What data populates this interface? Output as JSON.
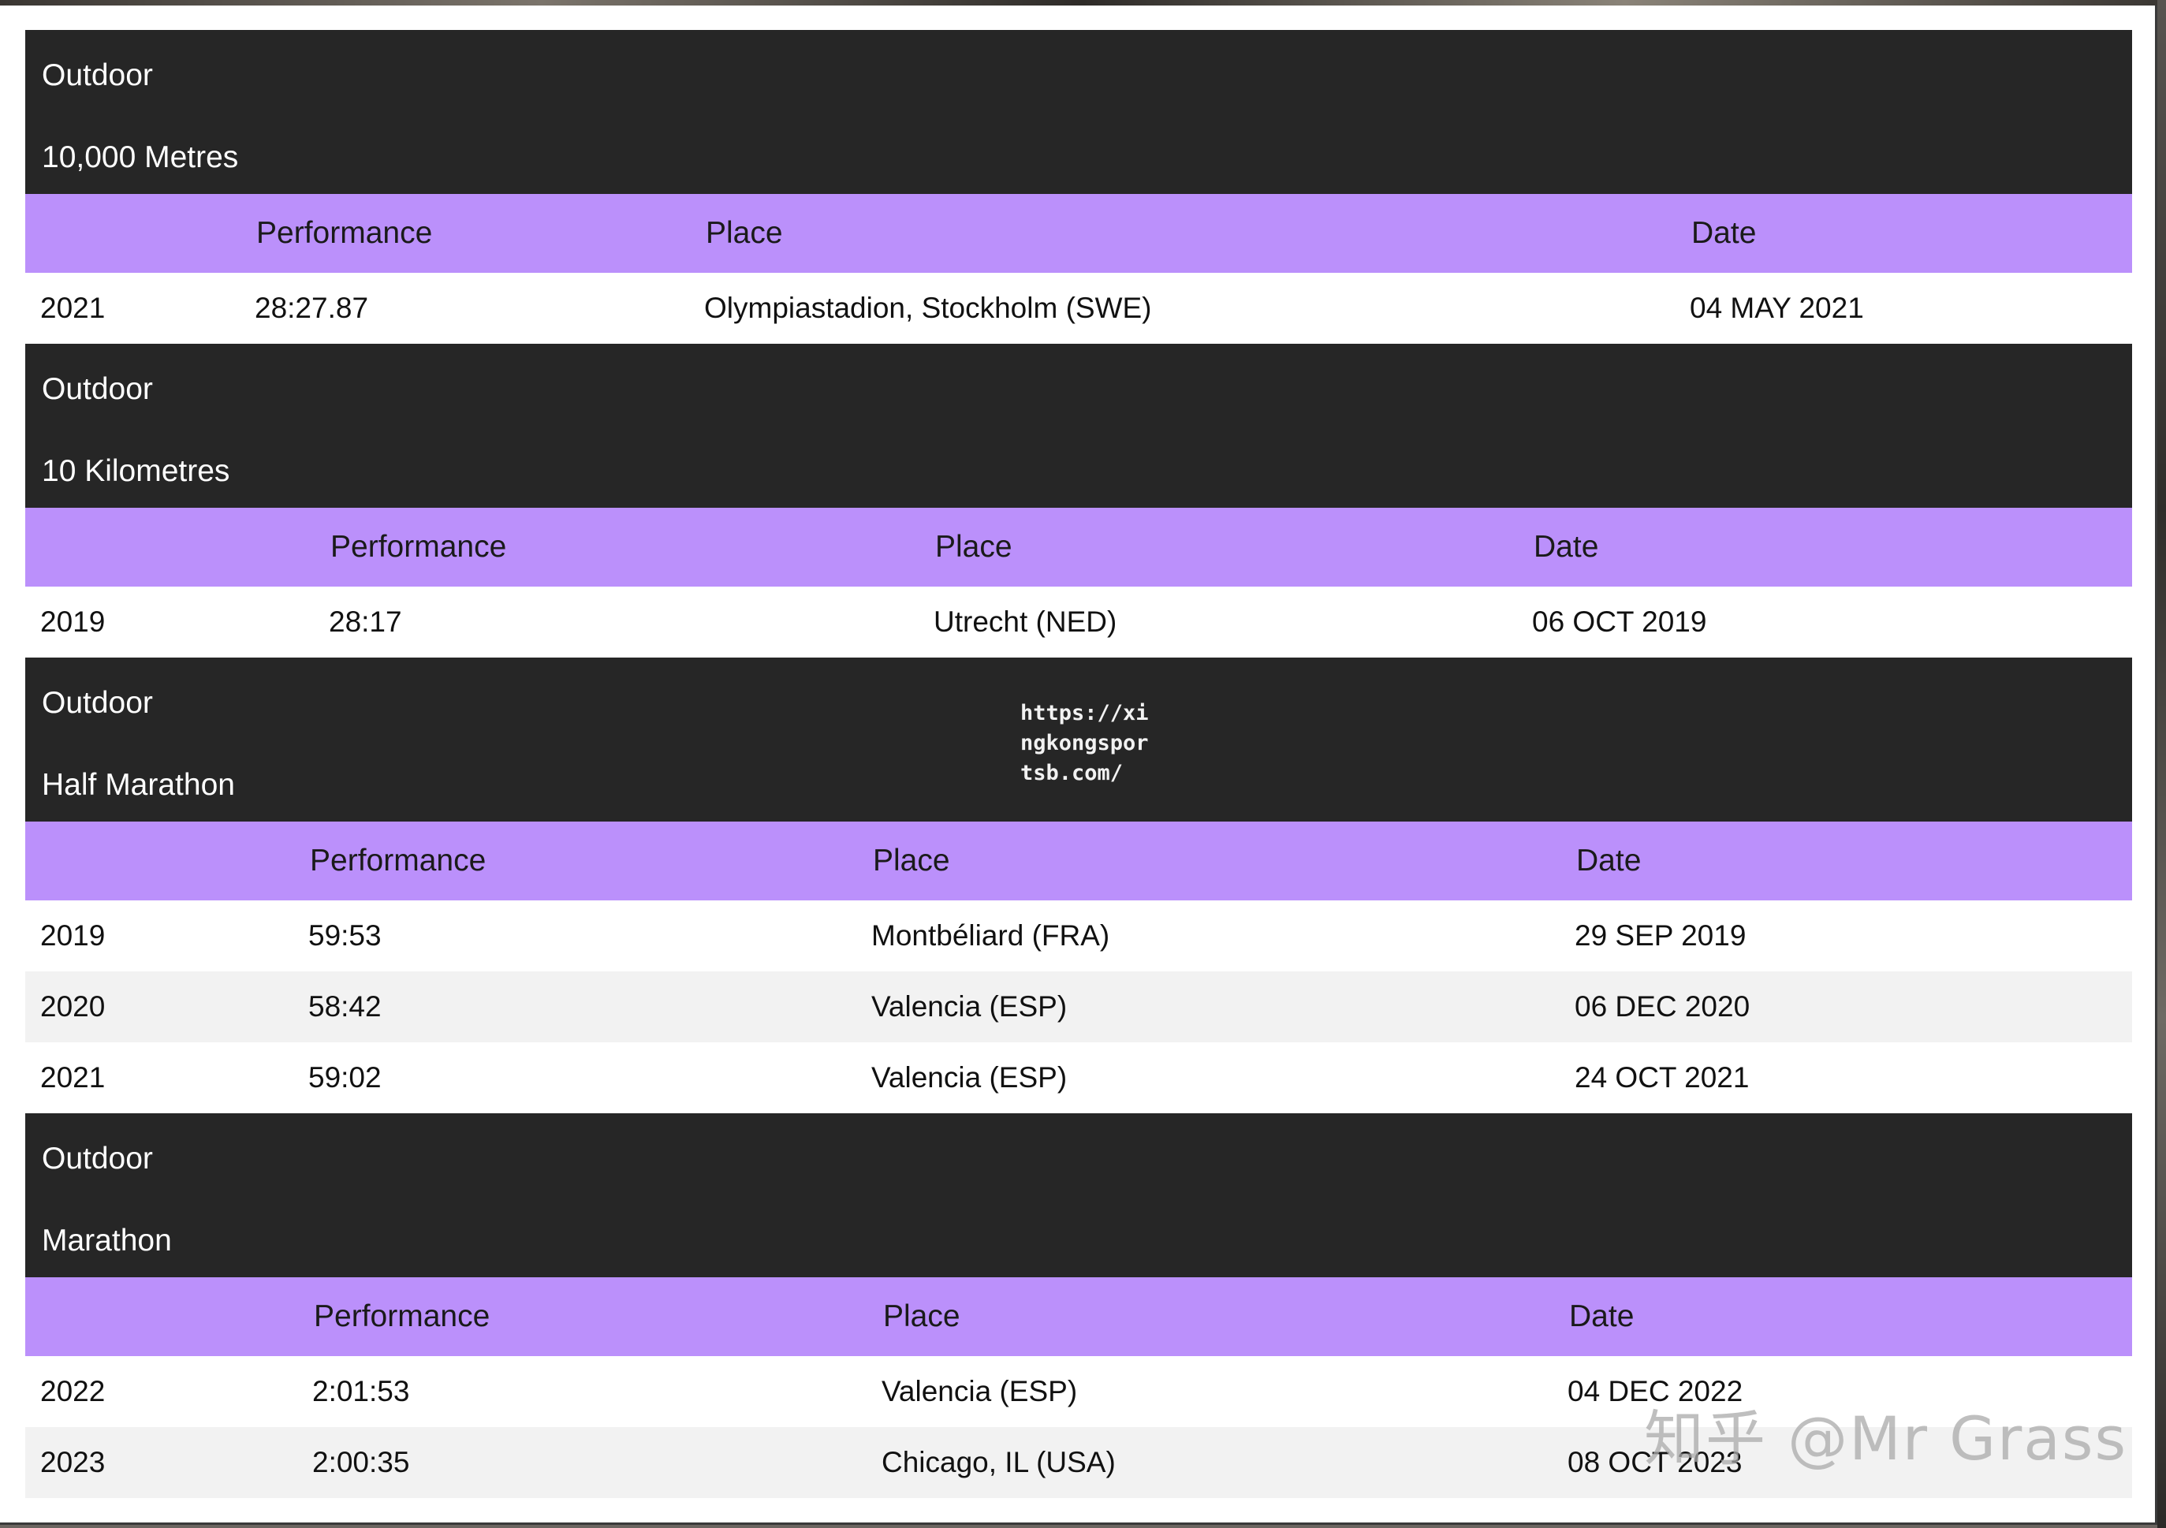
{
  "watermark": {
    "url": "https://xi\nngkongspor\ntsb.com/",
    "credit": "知乎 @Mr Grass"
  },
  "sections": [
    {
      "environment": "Outdoor",
      "event": "10,000 Metres",
      "headers": {
        "performance": "Performance",
        "place": "Place",
        "date": "Date"
      },
      "rows": [
        {
          "year": "2021",
          "performance": "28:27.87",
          "place": "Olympiastadion, Stockholm (SWE)",
          "date": "04 MAY 2021"
        }
      ]
    },
    {
      "environment": "Outdoor",
      "event": "10 Kilometres",
      "headers": {
        "performance": "Performance",
        "place": "Place",
        "date": "Date"
      },
      "rows": [
        {
          "year": "2019",
          "performance": "28:17",
          "place": "Utrecht (NED)",
          "date": "06 OCT 2019"
        }
      ]
    },
    {
      "environment": "Outdoor",
      "event": "Half Marathon",
      "headers": {
        "performance": "Performance",
        "place": "Place",
        "date": "Date"
      },
      "rows": [
        {
          "year": "2019",
          "performance": "59:53",
          "place": "Montbéliard (FRA)",
          "date": "29 SEP 2019"
        },
        {
          "year": "2020",
          "performance": "58:42",
          "place": "Valencia (ESP)",
          "date": "06 DEC 2020"
        },
        {
          "year": "2021",
          "performance": "59:02",
          "place": "Valencia (ESP)",
          "date": "24 OCT 2021"
        }
      ]
    },
    {
      "environment": "Outdoor",
      "event": "Marathon",
      "headers": {
        "performance": "Performance",
        "place": "Place",
        "date": "Date"
      },
      "rows": [
        {
          "year": "2022",
          "performance": "2:01:53",
          "place": "Valencia (ESP)",
          "date": "04 DEC 2022"
        },
        {
          "year": "2023",
          "performance": "2:00:35",
          "place": "Chicago, IL (USA)",
          "date": "08 OCT 2023"
        }
      ]
    }
  ]
}
